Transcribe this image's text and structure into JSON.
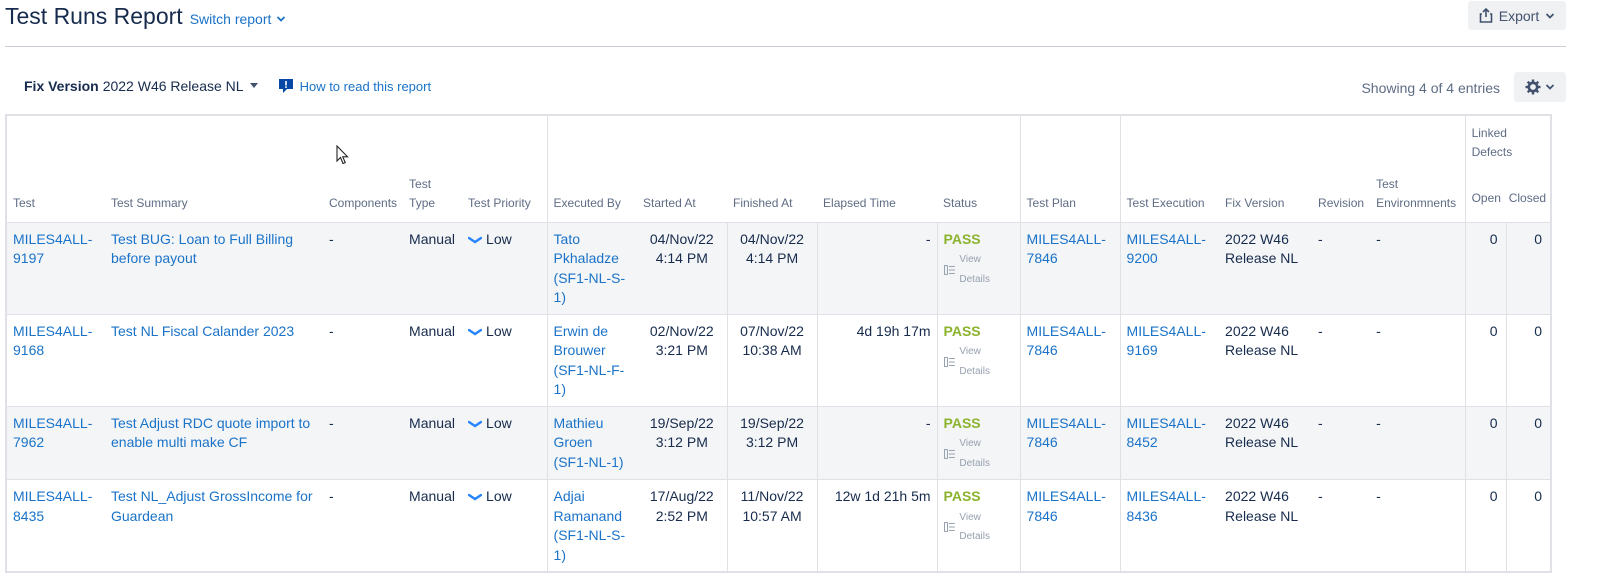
{
  "header": {
    "title": "Test Runs Report",
    "switch_label": "Switch report",
    "export_label": "Export"
  },
  "toolbar": {
    "fix_version_label": "Fix Version",
    "fix_version_value": "2022 W46 Release NL",
    "howto_label": "How to read this report",
    "showing": "Showing 4 of 4 entries"
  },
  "table": {
    "columns": {
      "test": "Test",
      "summary": "Test Summary",
      "components": "Components",
      "type_1": "Test",
      "type_2": "Type",
      "priority": "Test Priority",
      "executed_by": "Executed By",
      "started": "Started At",
      "finished": "Finished At",
      "elapsed": "Elapsed Time",
      "status": "Status",
      "plan": "Test Plan",
      "execution": "Test Execution",
      "fix_version": "Fix Version",
      "revision": "Revision",
      "env_1": "Test",
      "env_2": "Environmnents",
      "linked_1": "Linked",
      "linked_2": "Defects",
      "open": "Open",
      "closed": "Closed"
    },
    "rows": [
      {
        "test": "MILES4ALL-9197",
        "summary": "Test BUG: Loan to Full Billing before payout",
        "components": "-",
        "type": "Manual",
        "priority": "Low",
        "executed_by": "Tato Pkhaladze (SF1-NL-S-1)",
        "started_date": "04/Nov/22",
        "started_time": "4:14 PM",
        "finished_date": "04/Nov/22",
        "finished_time": "4:14 PM",
        "elapsed": "-",
        "status": "PASS",
        "view_details": "View Details",
        "plan": "MILES4ALL-7846",
        "execution": "MILES4ALL-9200",
        "fix_version": "2022 W46 Release NL",
        "revision": "-",
        "env": "-",
        "open": "0",
        "closed": "0"
      },
      {
        "test": "MILES4ALL-9168",
        "summary": "Test NL Fiscal Calander 2023",
        "components": "-",
        "type": "Manual",
        "priority": "Low",
        "executed_by": "Erwin de Brouwer (SF1-NL-F-1)",
        "started_date": "02/Nov/22",
        "started_time": "3:21 PM",
        "finished_date": "07/Nov/22",
        "finished_time": "10:38 AM",
        "elapsed": "4d 19h 17m",
        "status": "PASS",
        "view_details": "View Details",
        "plan": "MILES4ALL-7846",
        "execution": "MILES4ALL-9169",
        "fix_version": "2022 W46 Release NL",
        "revision": "-",
        "env": "-",
        "open": "0",
        "closed": "0"
      },
      {
        "test": "MILES4ALL-7962",
        "summary": "Test Adjust RDC quote import to enable multi make CF",
        "components": "-",
        "type": "Manual",
        "priority": "Low",
        "executed_by": "Mathieu Groen (SF1-NL-1)",
        "started_date": "19/Sep/22",
        "started_time": "3:12 PM",
        "finished_date": "19/Sep/22",
        "finished_time": "3:12 PM",
        "elapsed": "-",
        "status": "PASS",
        "view_details": "View Details",
        "plan": "MILES4ALL-7846",
        "execution": "MILES4ALL-8452",
        "fix_version": "2022 W46 Release NL",
        "revision": "-",
        "env": "-",
        "open": "0",
        "closed": "0"
      },
      {
        "test": "MILES4ALL-8435",
        "summary": "Test NL_Adjust GrossIncome for Guardean",
        "components": "-",
        "type": "Manual",
        "priority": "Low",
        "executed_by": "Adjai Ramanand (SF1-NL-S-1)",
        "started_date": "17/Aug/22",
        "started_time": "2:52 PM",
        "finished_date": "11/Nov/22",
        "finished_time": "10:57 AM",
        "elapsed": "12w 1d 21h 5m",
        "status": "PASS",
        "view_details": "View Details",
        "plan": "MILES4ALL-7846",
        "execution": "MILES4ALL-8436",
        "fix_version": "2022 W46 Release NL",
        "revision": "-",
        "env": "-",
        "open": "0",
        "closed": "0"
      }
    ]
  },
  "colors": {
    "link": "#1a73c8",
    "pass": "#8bb32e",
    "row_alt": "#f4f5f7",
    "priority_low": "#2684ff"
  }
}
